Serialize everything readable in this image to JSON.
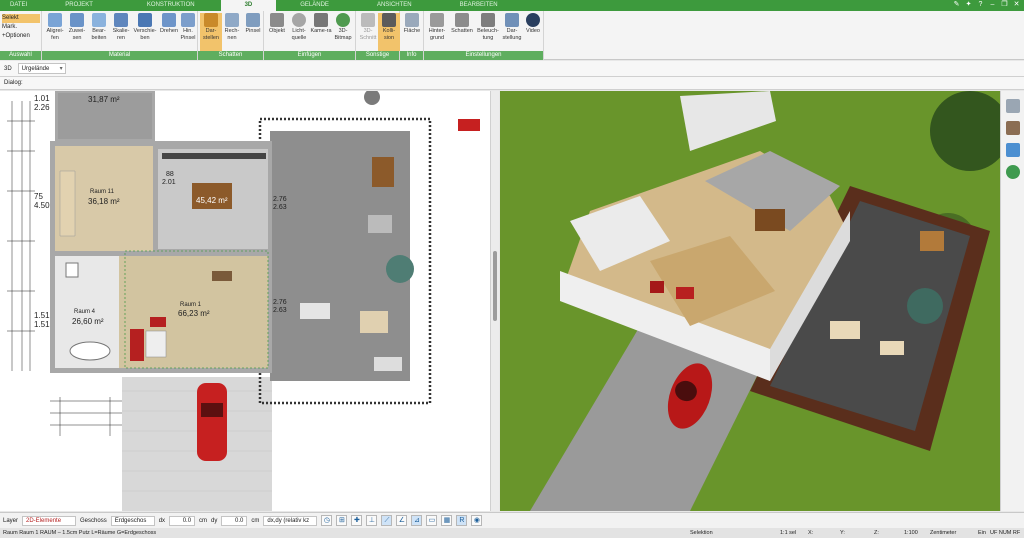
{
  "menu": {
    "tabs": [
      "DATEI",
      "PROJEKT",
      "KONSTRUKTION",
      "3D",
      "GELÄNDE",
      "ANSICHTEN",
      "BEARBEITEN"
    ],
    "active": "3D"
  },
  "ribbon": {
    "auswahl": {
      "selekt": "Selekt",
      "mark": "Mark.",
      "optionen": "+Optionen",
      "label": "Auswahl"
    },
    "material": {
      "label": "Material",
      "buttons": [
        "Aligrei-fen",
        "Zuwei-sen",
        "Bear-beiten",
        "Skalie-ren",
        "Verschie-ben",
        "Drehen",
        "Hin. Pinsel"
      ]
    },
    "schatten": {
      "label": "Schatten",
      "buttons": [
        "Dar-stellen",
        "Rech-nen",
        "Pinsel"
      ]
    },
    "einfuegen": {
      "label": "Einfügen",
      "buttons": [
        "Objekt",
        "Licht-quelle",
        "Kame-ra",
        "3D-Bitmap"
      ]
    },
    "sonstige": {
      "label": "Sonstige",
      "buttons": [
        "3D-Schnitt",
        "Kolli-sion"
      ]
    },
    "info": {
      "label": "Info",
      "buttons": [
        "Fläche"
      ]
    },
    "einstellungen": {
      "label": "Einstellungen",
      "buttons": [
        "Hinter-grund",
        "Schatten",
        "Beleuch-tung",
        "Dar-stellung",
        "Video"
      ]
    }
  },
  "toolbar2": {
    "mode": "3D",
    "dropdown": "Urgelände"
  },
  "dialog": {
    "label": "Dialog:"
  },
  "plan": {
    "rooms": [
      {
        "name": "",
        "area": "31,87 m²"
      },
      {
        "name": "Raum 11",
        "area": "36,18 m²"
      },
      {
        "name": "",
        "area": "45,42 m²"
      },
      {
        "name": "Raum 1",
        "area": "66,23 m²"
      },
      {
        "name": "Raum 4",
        "area": "26,60 m²"
      }
    ],
    "left_dims": [
      "1.01",
      "2.26",
      "75",
      "4.50",
      "1.51",
      "1.51"
    ],
    "inner_dims": [
      "88",
      "2.01",
      "2.76",
      "2.63",
      "2.76",
      "2.63"
    ]
  },
  "statusbar": {
    "layer_label": "Layer",
    "layer_value": "2D-Elemente",
    "geschoss_label": "Geschoss",
    "geschoss_value": "Erdgeschos",
    "dx_label": "dx",
    "dx_value": "0.0",
    "dx_unit": "cm",
    "dy_label": "dy",
    "dy_value": "0.0",
    "dy_unit": "cm",
    "coord_mode": "dx,dy (relativ kz",
    "info": "Raum Raum 1 RAUM – 1.5cm Putz L=Räume G=Erdgeschoss",
    "selektion": "Selektion",
    "scale_sel": "1:1 sel",
    "x_label": "X:",
    "y_label": "Y:",
    "z_label": "Z:",
    "scale": "1:100",
    "unit": "Zentimeter",
    "ein": "Ein",
    "flags": "UF NUM RF"
  },
  "colors": {
    "accent_green": "#3d9a3d",
    "active_yellow": "#f2c36b"
  }
}
